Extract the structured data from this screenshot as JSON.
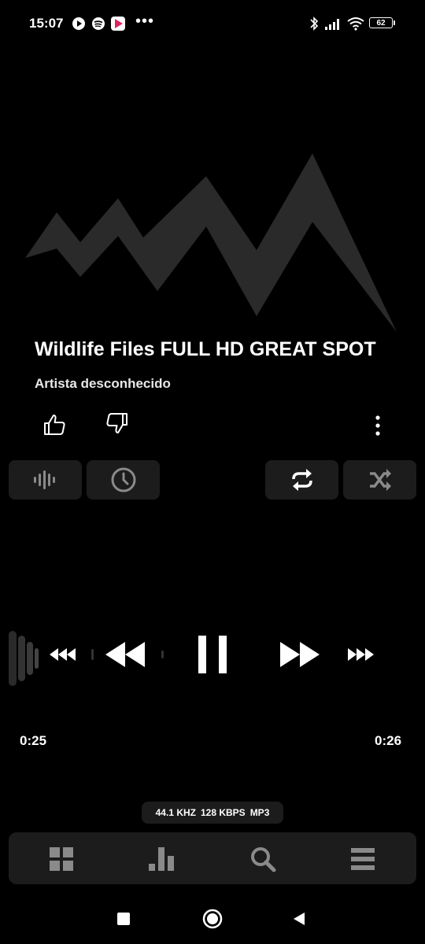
{
  "status_bar": {
    "time": "15:07",
    "battery_level": "62",
    "notification_icons": [
      "play-icon",
      "spotify-icon",
      "app-icon"
    ],
    "system_icons": [
      "bluetooth-icon",
      "signal-icon",
      "wifi-icon",
      "battery-icon"
    ]
  },
  "track": {
    "title": "Wildlife Files FULL HD GREAT SPOT",
    "artist": "Artista desconhecido"
  },
  "progress": {
    "elapsed": "0:25",
    "total": "0:26"
  },
  "format": {
    "sample_rate": "44.1 KHZ",
    "bitrate": "128 KBPS",
    "codec": "MP3"
  },
  "colors": {
    "background": "#000000",
    "tile": "#1c1c1c",
    "icon_muted": "#8a8a8a",
    "artwork": "#2a2a2a",
    "text": "#ffffff"
  },
  "state": {
    "playing": true
  }
}
